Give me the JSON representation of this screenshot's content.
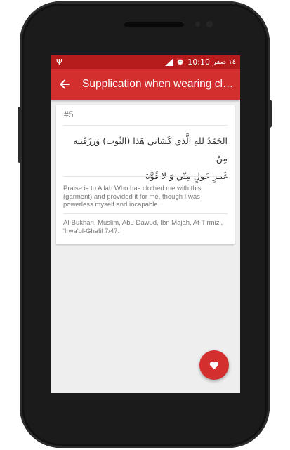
{
  "statusbar": {
    "time": "10:10",
    "date": "١٤ صفر",
    "icons": [
      "usb-icon",
      "signal-icon",
      "alarm-icon"
    ]
  },
  "toolbar": {
    "title": "Supplication when wearing clot...",
    "back_icon": "arrow-left-icon"
  },
  "dua": {
    "number": "#5",
    "arabic_line1": "الحَمْدُ للهِ الَّذي كَسَاني هَذا (الثّوب) وَرَزَقَنيه مِنْ",
    "arabic_line2": "غَيـرِ حَولٍ مِنّي وَ لا قُوَّة",
    "translation": "Praise is to Allah Who has clothed me with this (garment) and provided it for me, though I was powerless myself and incapable.",
    "reference": "Al-Bukhari, Muslim, Abu Dawud, Ibn Majah, At-Tirmizi, 'Irwa'ul-Ghalil 7/47."
  },
  "fab": {
    "icon": "heart-icon"
  },
  "colors": {
    "primary": "#d32f2f",
    "primary_dark": "#b71c1c",
    "background": "#eeeeee",
    "card": "#ffffff"
  }
}
